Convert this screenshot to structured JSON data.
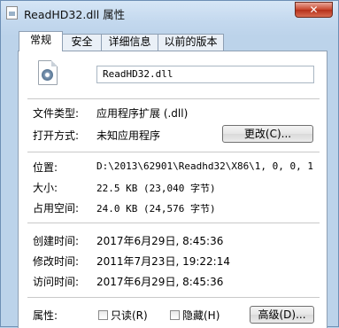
{
  "window": {
    "title": "ReadHD32.dll 属性",
    "close_glyph": "✕"
  },
  "tabs": [
    {
      "label": "常规",
      "active": true
    },
    {
      "label": "安全"
    },
    {
      "label": "详细信息"
    },
    {
      "label": "以前的版本"
    }
  ],
  "general": {
    "file_name": "ReadHD32.dll",
    "file_type_label": "文件类型:",
    "file_type_value": "应用程序扩展 (.dll)",
    "open_with_label": "打开方式:",
    "open_with_value": "未知应用程序",
    "change_button": "更改(C)...",
    "location_label": "位置:",
    "location_value": "D:\\2013\\62901\\Readhd32\\X86\\1, 0, 0, 1",
    "size_label": "大小:",
    "size_value": "22.5 KB (23,040 字节)",
    "size_on_disk_label": "占用空间:",
    "size_on_disk_value": "24.0 KB (24,576 字节)",
    "created_label": "创建时间:",
    "created_value": "2017年6月29日, 8:45:36",
    "modified_label": "修改时间:",
    "modified_value": "2011年7月23日, 19:22:14",
    "accessed_label": "访问时间:",
    "accessed_value": "2017年6月29日, 8:45:36",
    "attributes_label": "属性:",
    "readonly_label": "只读(R)",
    "hidden_label": "隐藏(H)",
    "advanced_button": "高级(D)..."
  },
  "icons": {
    "title_icon": "dll-file-icon",
    "file_icon": "dll-gear-file-icon"
  }
}
